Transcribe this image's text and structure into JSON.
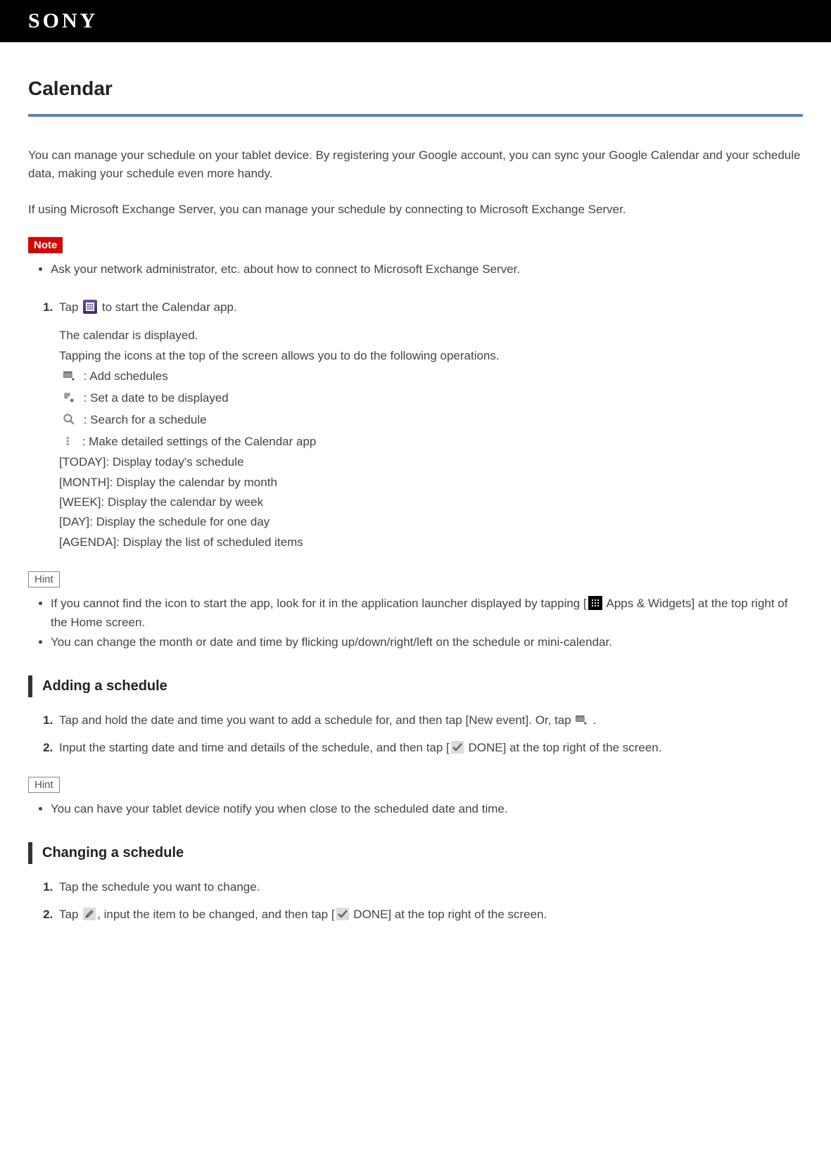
{
  "header": {
    "logo": "SONY"
  },
  "title": "Calendar",
  "intro1": "You can manage your schedule on your tablet device. By registering your Google account, you can sync your Google Calendar and your schedule data, making your schedule even more handy.",
  "intro2": "If using Microsoft Exchange Server, you can manage your schedule by connecting to Microsoft Exchange Server.",
  "note": {
    "label": "Note",
    "items": [
      "Ask your network administrator, etc. about how to connect to Microsoft Exchange Server."
    ]
  },
  "step1": {
    "pre": "Tap ",
    "post": " to start the Calendar app.",
    "displayed": "The calendar is displayed.",
    "tapping": "Tapping the icons at the top of the screen allows you to do the following operations.",
    "icon_add": " : Add schedules",
    "icon_date": " : Set a date to be displayed",
    "icon_search": " : Search for a schedule",
    "icon_overflow": " : Make detailed settings of the Calendar app",
    "today": "[TODAY]: Display today's schedule",
    "month": "[MONTH]: Display the calendar by month",
    "week": "[WEEK]: Display the calendar by week",
    "day": "[DAY]: Display the schedule for one day",
    "agenda": "[AGENDA]: Display the list of scheduled items"
  },
  "hint1": {
    "label": "Hint",
    "item1a": "If you cannot find the icon to start the app, look for it in the application launcher displayed by tapping [",
    "item1b": " Apps & Widgets] at the top right of the Home screen.",
    "item2": "You can change the month or date and time by flicking up/down/right/left on the schedule or mini-calendar."
  },
  "adding": {
    "heading": "Adding a schedule",
    "s1a": "Tap and hold the date and time you want to add a schedule for, and then tap [New event]. Or, tap ",
    "s1b": ".",
    "s2a": "Input the starting date and time and details of the schedule, and then tap [",
    "s2b": " DONE] at the top right of the screen."
  },
  "hint2": {
    "label": "Hint",
    "item1": "You can have your tablet device notify you when close to the scheduled date and time."
  },
  "changing": {
    "heading": "Changing a schedule",
    "s1": "Tap the schedule you want to change.",
    "s2a": "Tap ",
    "s2b": ", input the item to be changed, and then tap [",
    "s2c": " DONE] at the top right of the screen."
  }
}
